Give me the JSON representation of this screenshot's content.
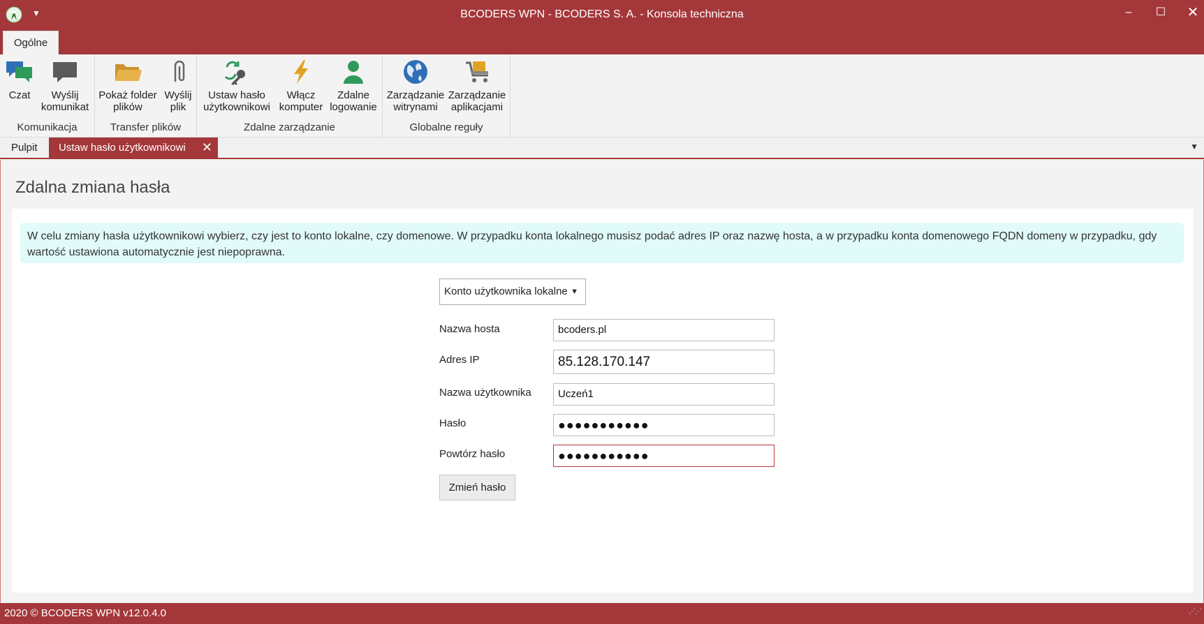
{
  "window": {
    "title": "BCODERS WPN - BCODERS S. A. - Konsola techniczna",
    "minimize": "–",
    "maximize": "☐",
    "close": "✕"
  },
  "ribbon": {
    "tab": "Ogólne",
    "groups": [
      {
        "label": "Komunikacja",
        "buttons": [
          {
            "label1": "Czat",
            "label2": "",
            "icon": "chat-icon"
          },
          {
            "label1": "Wyślij",
            "label2": "komunikat",
            "icon": "message-icon"
          }
        ]
      },
      {
        "label": "Transfer plików",
        "buttons": [
          {
            "label1": "Pokaż folder",
            "label2": "plików",
            "icon": "folder-icon"
          },
          {
            "label1": "Wyślij",
            "label2": "plik",
            "icon": "paperclip-icon"
          }
        ]
      },
      {
        "label": "Zdalne zarządzanie",
        "buttons": [
          {
            "label1": "Ustaw hasło",
            "label2": "użytkownikowi",
            "icon": "key-refresh-icon"
          },
          {
            "label1": "Włącz",
            "label2": "komputer",
            "icon": "lightning-icon"
          },
          {
            "label1": "Zdalne",
            "label2": "logowanie",
            "icon": "user-icon"
          }
        ]
      },
      {
        "label": "Globalne reguły",
        "buttons": [
          {
            "label1": "Zarządzanie",
            "label2": "witrynami",
            "icon": "globe-icon"
          },
          {
            "label1": "Zarządzanie",
            "label2": "aplikacjami",
            "icon": "cart-icon"
          }
        ]
      }
    ]
  },
  "doctabs": {
    "items": [
      {
        "label": "Pulpit"
      },
      {
        "label": "Ustaw hasło użytkownikowi",
        "active": true
      }
    ],
    "close": "✕",
    "dropdown": "▼"
  },
  "main": {
    "title": "Zdalna zmiana hasła",
    "info": "W celu zmiany hasła użytkownikowi wybierz, czy jest to konto lokalne, czy domenowe. W przypadku konta lokalnego musisz podać adres IP oraz nazwę hosta, a w przypadku konta domenowego FQDN domeny w przypadku, gdy wartość ustawiona automatycznie jest niepoprawna.",
    "account_type": "Konto użytkownika lokalne",
    "fields": [
      {
        "label": "Nazwa hosta",
        "value": "bcoders.pl"
      },
      {
        "label": "Adres IP",
        "value": "85.128.170.147"
      },
      {
        "label": "Nazwa użytkownika",
        "value": "Uczeń1"
      },
      {
        "label": "Hasło",
        "value": "●●●●●●●●●●●"
      },
      {
        "label": "Powtórz hasło",
        "value": "●●●●●●●●●●●"
      }
    ],
    "submit": "Zmień hasło"
  },
  "status": {
    "text": "2020 ©  BCODERS WPN v12.0.4.0"
  },
  "colors": {
    "accent": "#a4373a",
    "info_bg": "#e1fafa"
  }
}
